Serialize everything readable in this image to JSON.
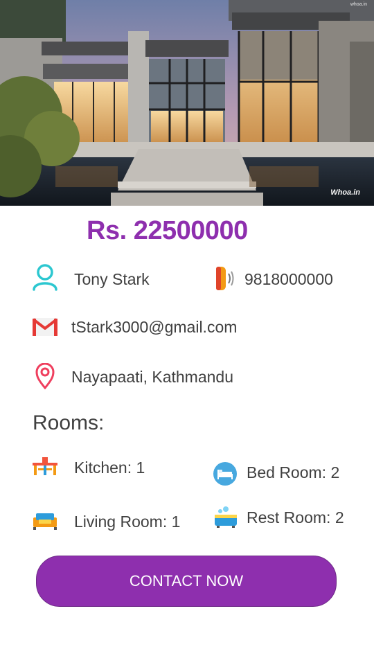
{
  "hero": {
    "image": "modern-house-photo",
    "watermark_small": "whoa.in",
    "watermark": "Whoa.in"
  },
  "listing": {
    "price": "Rs. 22500000",
    "owner_name": "Tony Stark",
    "phone": "9818000000",
    "email": "tStark3000@gmail.com",
    "location": "Nayapaati, Kathmandu"
  },
  "rooms": {
    "heading": "Rooms:",
    "items": [
      {
        "label": "Kitchen: 1",
        "icon": "kitchen-icon"
      },
      {
        "label": "Bed Room: 2",
        "icon": "bed-icon"
      },
      {
        "label": "Living Room: 1",
        "icon": "sofa-icon"
      },
      {
        "label": "Rest Room: 2",
        "icon": "bathtub-icon"
      }
    ]
  },
  "actions": {
    "contact_label": "CONTACT NOW"
  },
  "colors": {
    "accent": "#8e2fae",
    "text": "#404040"
  }
}
